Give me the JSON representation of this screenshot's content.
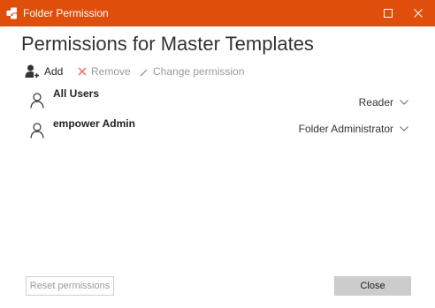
{
  "window": {
    "title": "Folder Permission",
    "accent_color": "#e04e0b",
    "icons": {
      "app": "folder-permission-icon",
      "maximize": "maximize-icon",
      "close": "close-icon"
    }
  },
  "heading": "Permissions for Master Templates",
  "toolbar": {
    "add_label": "Add",
    "remove_label": "Remove",
    "change_label": "Change permission"
  },
  "users": [
    {
      "name": "All Users",
      "permission": "Reader"
    },
    {
      "name": "empower Admin",
      "permission": "Folder Administrator"
    }
  ],
  "footer": {
    "reset_label": "Reset permissions",
    "close_label": "Close"
  }
}
